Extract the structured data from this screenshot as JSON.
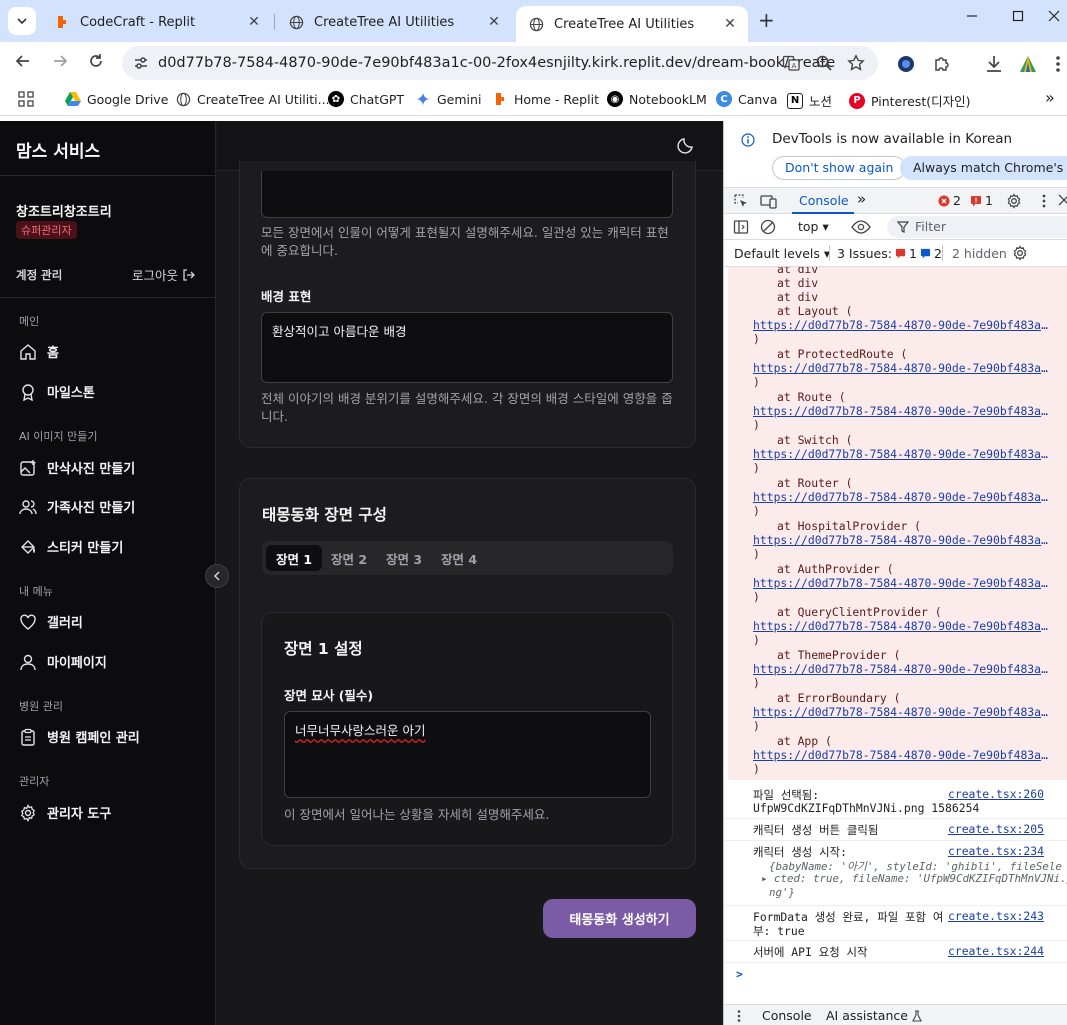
{
  "browser": {
    "tabs": [
      {
        "title": "CodeCraft - Replit",
        "active": false
      },
      {
        "title": "CreateTree AI Utilities",
        "active": false
      },
      {
        "title": "CreateTree AI Utilities",
        "active": true
      }
    ],
    "new_tab": "+",
    "url": "d0d77b78-7584-4870-90de-7e90bf483a1c-00-2fox4esnjilty.kirk.replit.dev/dream-book/create",
    "bookmarks": [
      "Google Drive",
      "CreateTree AI Utiliti...",
      "ChatGPT",
      "Gemini",
      "Home - Replit",
      "NotebookLM",
      "Canva",
      "노션",
      "Pinterest(디자인)"
    ],
    "bookmark_more": "»"
  },
  "app": {
    "brand": "맘스 서비스",
    "user": {
      "name": "창조트리창조트리",
      "role": "슈퍼관리자"
    },
    "account_label": "계정 관리",
    "logout_label": "로그아웃",
    "sections": [
      {
        "label": "메인",
        "items": [
          "홈",
          "마일스톤"
        ]
      },
      {
        "label": "AI 이미지 만들기",
        "items": [
          "만삭사진 만들기",
          "가족사진 만들기",
          "스티커 만들기"
        ]
      },
      {
        "label": "내 메뉴",
        "items": [
          "갤러리",
          "마이페이지"
        ]
      },
      {
        "label": "병원 관리",
        "items": [
          "병원 캠페인 관리"
        ]
      },
      {
        "label": "관리자",
        "items": [
          "관리자 도구"
        ]
      }
    ],
    "character_help": "모든 장면에서 인물이 어떻게 표현될지 설명해주세요. 일관성 있는 캐릭터 표현에 중요합니다.",
    "background_label": "배경 표현",
    "background_value": "환상적이고 아름다운 배경",
    "background_help": "전체 이야기의 배경 분위기를 설명해주세요. 각 장면의 배경 스타일에 영향을 줍니다.",
    "scene_card_title": "태몽동화 장면 구성",
    "scene_tabs": [
      "장면 1",
      "장면 2",
      "장면 3",
      "장면 4"
    ],
    "scene_settings_title": "장면 1 설정",
    "scene_desc_label": "장면 묘사 (필수)",
    "scene_desc_value": "너무너무사랑스러운 아기",
    "scene_desc_help": "이 장면에서 일어나는 상황을 자세히 설명해주세요.",
    "generate_button": "태몽동화 생성하기"
  },
  "devtools": {
    "info_message": "DevTools is now available in Korean",
    "info_btn_dismiss": "Don't show again",
    "info_btn_match": "Always match Chrome's language",
    "panel_tab": "Console",
    "error_count": "2",
    "warn_count": "1",
    "context": "top",
    "filter_placeholder": "Filter",
    "default_levels": "Default levels",
    "issues_label": "3 Issues:",
    "issues_err": "1",
    "issues_info": "2",
    "hidden": "2 hidden",
    "stack_link": "https://d0d77b78-7584-4870-90de-7e90bf483a1c-00-2fox4esnjilty.kirk.replit.dev",
    "stack": [
      "at div",
      "at div",
      "at div",
      "at Layout (",
      "at ProtectedRoute (",
      "at Route (",
      "at Switch (",
      "at Router (",
      "at HospitalProvider (",
      "at AuthProvider (",
      "at QueryClientProvider (",
      "at ThemeProvider (",
      "at ErrorBoundary (",
      "at App ("
    ],
    "paren": ")",
    "logs": [
      {
        "text1": "파일 선택됨:",
        "text2": "UfpW9CdKZIFqDThMnVJNi.png 1586254",
        "src": "create.tsx:260"
      },
      {
        "text1": "캐릭터 생성 버튼 클릭됨",
        "src": "create.tsx:205"
      },
      {
        "text1": "캐릭터 생성 시작:",
        "src": "create.tsx:234"
      },
      {
        "text1": "FormData 생성 완료, 파일 포함 여",
        "text2": "부: true",
        "src": "create.tsx:243"
      },
      {
        "text1": "서버에 API 요청 시작",
        "src": "create.tsx:244"
      }
    ],
    "obj_line1": "{babyName: '아기', styleId: 'ghibli', fileSele",
    "obj_line2": "cted: true, fileName: 'UfpW9CdKZIFqDThMnVJNi.p",
    "obj_line3": "ng'}",
    "prompt": ">",
    "bottom_tabs": [
      "Console",
      "AI assistance"
    ]
  }
}
